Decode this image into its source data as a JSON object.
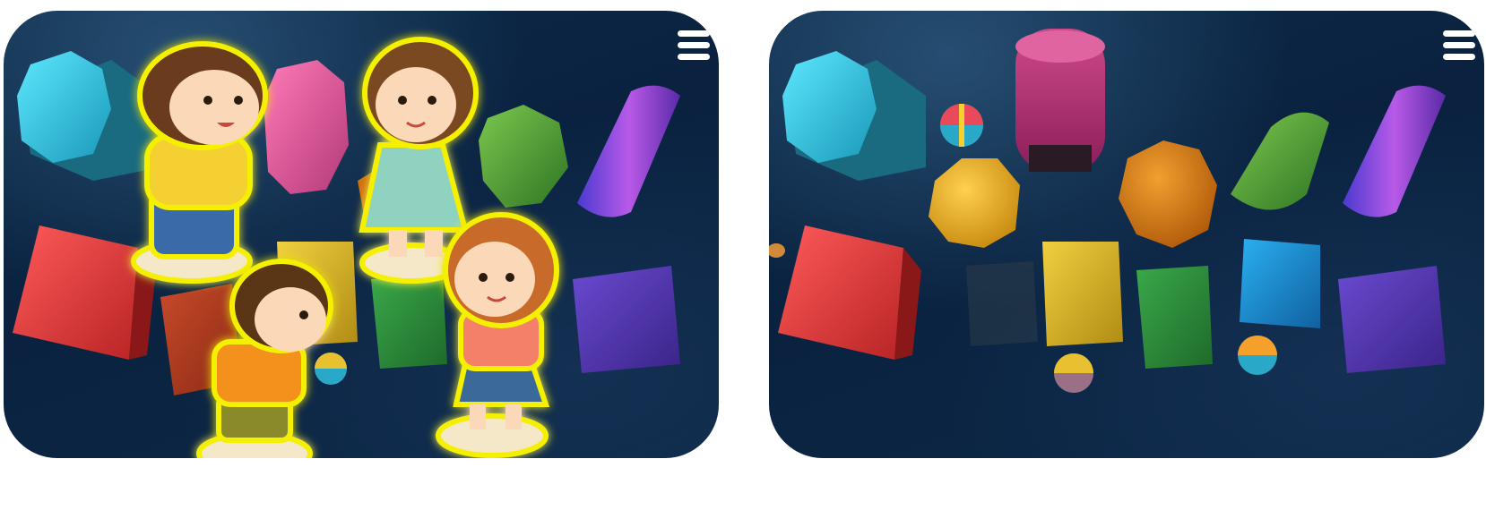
{
  "scene": {
    "title": "",
    "background_color": "#0a2240",
    "left_panel": {
      "view": "with-children",
      "menu_icon": "hamburger-menu-icon",
      "children_highlight_color": "#f4f000"
    },
    "right_panel": {
      "view": "toys-only",
      "menu_icon": "hamburger-menu-icon"
    }
  },
  "toy_colors": {
    "cyan": "#31c8e6",
    "pink": "#e0589a",
    "green": "#4b9a36",
    "purple": "#7a3fd0",
    "red": "#e23e3e",
    "yellow": "#d8b42a",
    "orange": "#e07c1a",
    "blue": "#1a7ec4",
    "violet": "#4b34a0"
  }
}
